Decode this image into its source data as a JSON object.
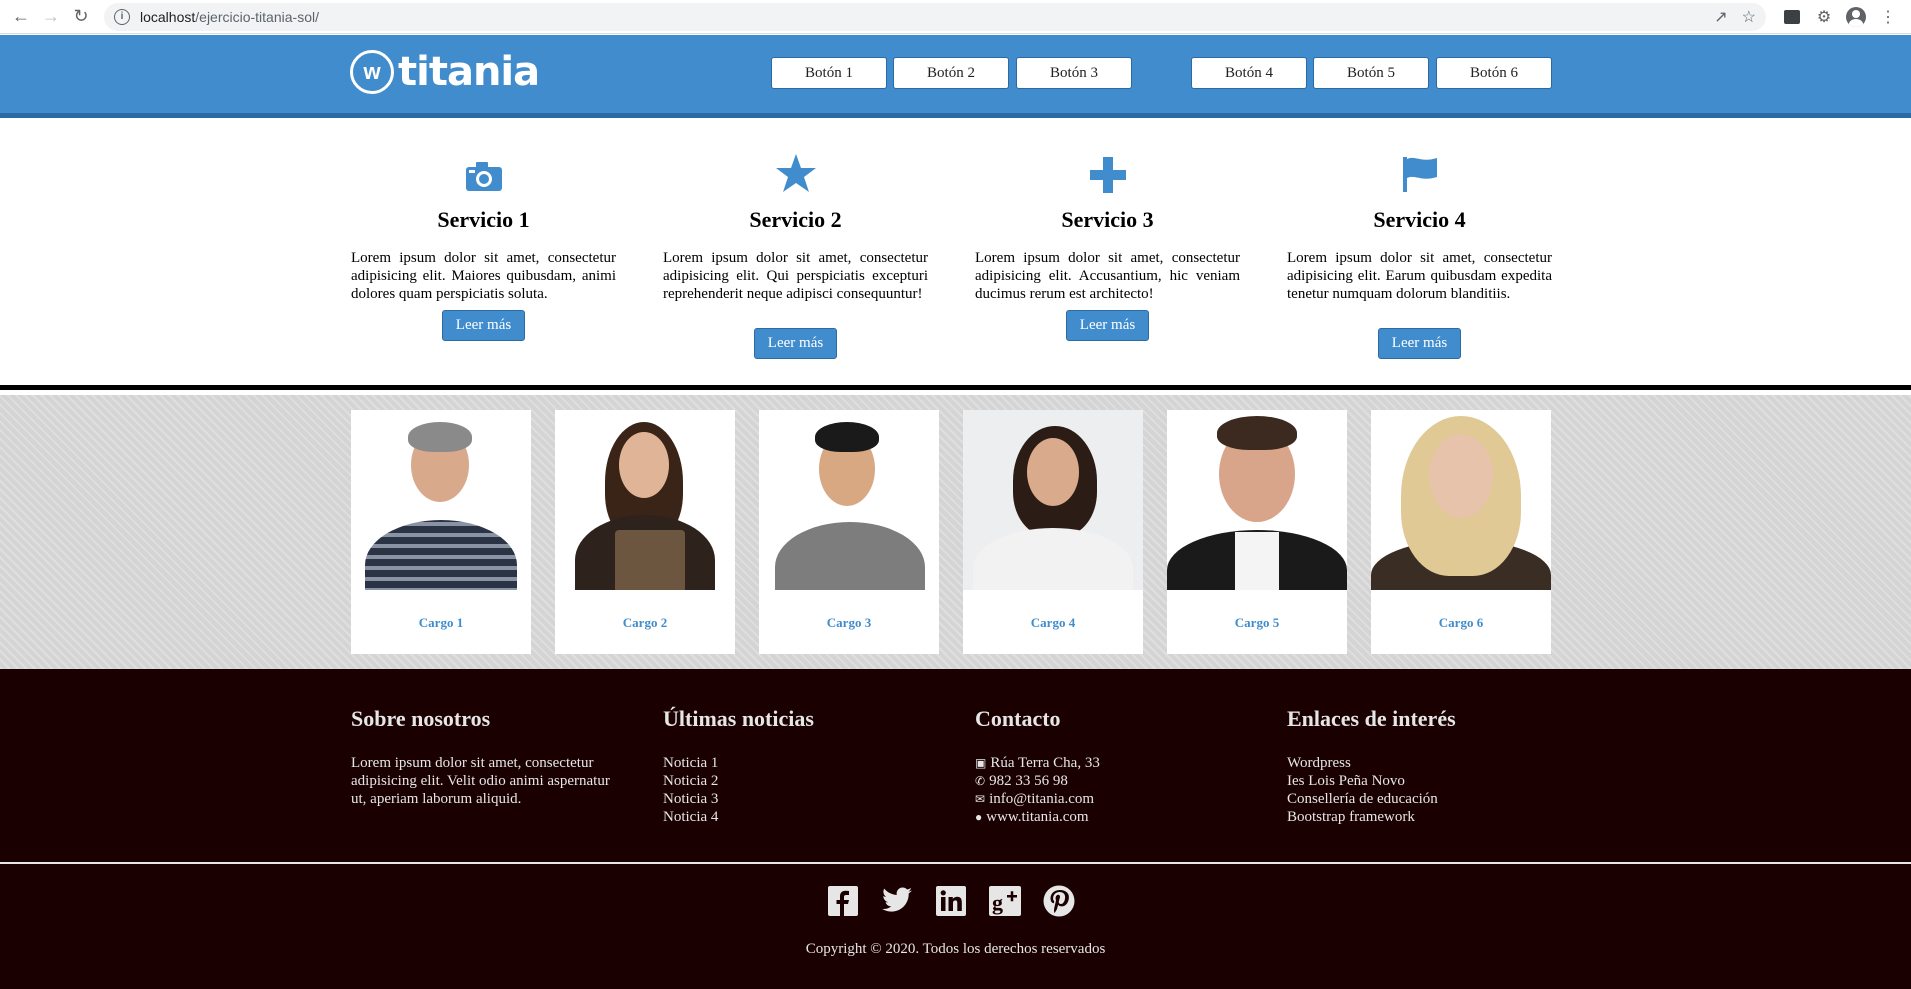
{
  "browser": {
    "url_host": "localhost",
    "url_path": "/ejercicio-titania-sol/"
  },
  "header": {
    "logo_text": "titania",
    "buttons": [
      "Botón 1",
      "Botón 2",
      "Botón 3",
      "Botón 4",
      "Botón 5",
      "Botón 6"
    ]
  },
  "services": [
    {
      "icon": "camera-icon",
      "title": "Servicio 1",
      "text": "Lorem ipsum dolor sit amet, consectetur adipisicing elit. Maiores quibusdam, animi dolores quam perspiciatis soluta.",
      "button": "Leer más"
    },
    {
      "icon": "star-icon",
      "title": "Servicio 2",
      "text": "Lorem ipsum dolor sit amet, consectetur adipisicing elit. Qui perspiciatis excepturi reprehenderit neque adipisci consequuntur!",
      "button": "Leer más"
    },
    {
      "icon": "plus-icon",
      "title": "Servicio 3",
      "text": "Lorem ipsum dolor sit amet, consectetur adipisicing elit. Accusantium, hic veniam ducimus rerum est architecto!",
      "button": "Leer más"
    },
    {
      "icon": "flag-icon",
      "title": "Servicio 4",
      "text": "Lorem ipsum dolor sit amet, consectetur adipisicing elit. Earum quibusdam expedita tenetur numquam dolorum blanditiis.",
      "button": "Leer más"
    }
  ],
  "team": [
    {
      "cargo": "Cargo 1"
    },
    {
      "cargo": "Cargo 2"
    },
    {
      "cargo": "Cargo 3"
    },
    {
      "cargo": "Cargo 4"
    },
    {
      "cargo": "Cargo 5"
    },
    {
      "cargo": "Cargo 6"
    }
  ],
  "footer": {
    "about": {
      "title": "Sobre nosotros",
      "text": "Lorem ipsum dolor sit amet, consectetur adipisicing elit. Velit odio animi aspernatur ut, aperiam laborum aliquid."
    },
    "news": {
      "title": "Últimas noticias",
      "items": [
        "Noticia 1",
        "Noticia 2",
        "Noticia 3",
        "Noticia 4"
      ]
    },
    "contact": {
      "title": "Contacto",
      "address": "Rúa Terra Cha, 33",
      "phone": "982 33 56 98",
      "email": "info@titania.com",
      "web": "www.titania.com"
    },
    "links": {
      "title": "Enlaces de interés",
      "items": [
        "Wordpress",
        "Ies Lois Peña Novo",
        "Consellería de educación",
        "Bootstrap framework"
      ]
    },
    "social": [
      "facebook-icon",
      "twitter-icon",
      "linkedin-icon",
      "googleplus-icon",
      "pinterest-icon"
    ],
    "copyright": "Copyright © 2020. Todos los derechos reservados"
  },
  "colors": {
    "brand_blue": "#418ccd",
    "footer_bg": "#1a0000"
  }
}
